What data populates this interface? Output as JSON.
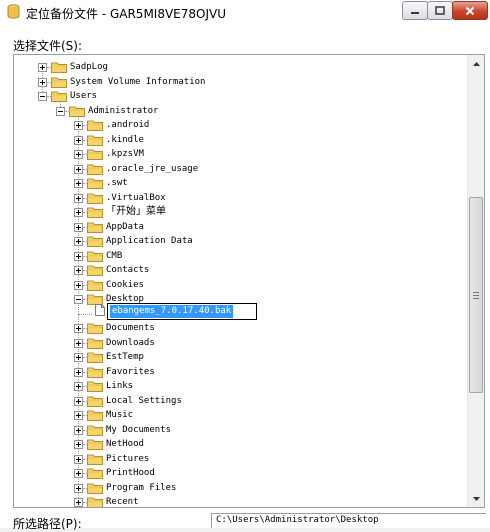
{
  "window": {
    "title": "定位备份文件 - GAR5MI8VE78OJVU",
    "min_icon": "minimize-icon",
    "max_icon": "maximize-icon",
    "close_icon": "close-icon"
  },
  "file_select_label": "选择文件(S):",
  "tree": [
    {
      "label": "SadpLog",
      "level": 1,
      "expander": "plus"
    },
    {
      "label": "System Volume Information",
      "level": 1,
      "expander": "plus"
    },
    {
      "label": "Users",
      "level": 1,
      "expander": "minus"
    },
    {
      "label": "Administrator",
      "level": 2,
      "expander": "minus"
    },
    {
      "label": ".android",
      "level": 3,
      "expander": "plus"
    },
    {
      "label": ".kindle",
      "level": 3,
      "expander": "plus"
    },
    {
      "label": ".kpzsVM",
      "level": 3,
      "expander": "plus"
    },
    {
      "label": ".oracle_jre_usage",
      "level": 3,
      "expander": "plus"
    },
    {
      "label": ".swt",
      "level": 3,
      "expander": "plus"
    },
    {
      "label": ".VirtualBox",
      "level": 3,
      "expander": "plus"
    },
    {
      "label": "「开始」菜单",
      "level": 3,
      "expander": "plus",
      "cjk": true
    },
    {
      "label": "AppData",
      "level": 3,
      "expander": "plus"
    },
    {
      "label": "Application Data",
      "level": 3,
      "expander": "plus"
    },
    {
      "label": "CMB",
      "level": 3,
      "expander": "plus"
    },
    {
      "label": "Contacts",
      "level": 3,
      "expander": "plus"
    },
    {
      "label": "Cookies",
      "level": 3,
      "expander": "plus"
    },
    {
      "label": "Desktop",
      "level": 3,
      "expander": "minus"
    },
    {
      "label": "",
      "level": 4,
      "expander": "none"
    },
    {
      "label": "Documents",
      "level": 3,
      "expander": "plus"
    },
    {
      "label": "Downloads",
      "level": 3,
      "expander": "plus"
    },
    {
      "label": "EstTemp",
      "level": 3,
      "expander": "plus"
    },
    {
      "label": "Favorites",
      "level": 3,
      "expander": "plus"
    },
    {
      "label": "Links",
      "level": 3,
      "expander": "plus"
    },
    {
      "label": "Local Settings",
      "level": 3,
      "expander": "plus"
    },
    {
      "label": "Music",
      "level": 3,
      "expander": "plus"
    },
    {
      "label": "My Documents",
      "level": 3,
      "expander": "plus"
    },
    {
      "label": "NetHood",
      "level": 3,
      "expander": "plus"
    },
    {
      "label": "Pictures",
      "level": 3,
      "expander": "plus"
    },
    {
      "label": "PrintHood",
      "level": 3,
      "expander": "plus"
    },
    {
      "label": "Program Files",
      "level": 3,
      "expander": "plus"
    },
    {
      "label": "Recent",
      "level": 3,
      "expander": "plus"
    }
  ],
  "editing_file": {
    "value": "ebangems_7.0.17.40.bak",
    "icon": "file-icon"
  },
  "scrollbar": {
    "up_icon": "scroll-up-icon",
    "down_icon": "scroll-down-icon",
    "position": 0.45
  },
  "path": {
    "label": "所选路径(P):",
    "value": "C:\\Users\\Administrator\\Desktop"
  },
  "colors": {
    "selection": "#3399ff",
    "folder": "#f6d36b",
    "close_button": "#c9462c"
  }
}
